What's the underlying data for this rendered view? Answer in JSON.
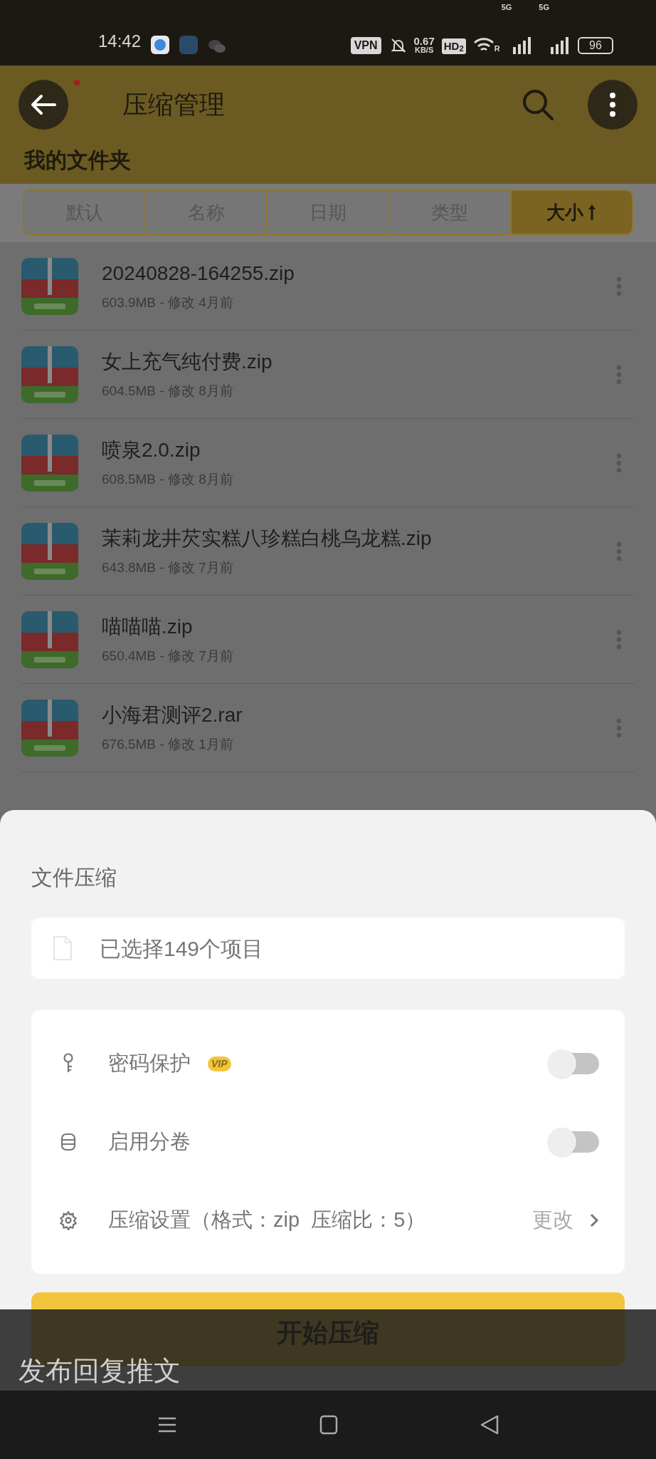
{
  "status_bar": {
    "time": "14:42",
    "vpn": "VPN",
    "speed": "0.67",
    "speed_unit": "KB/S",
    "hd": "HD$_{2}$",
    "roaming": "R",
    "network_1": "5G",
    "network_2": "5G",
    "battery": "96"
  },
  "header": {
    "title": "压缩管理",
    "section": "我的文件夹"
  },
  "sort_tabs": [
    {
      "label": "默认",
      "selected": false
    },
    {
      "label": "名称",
      "selected": false
    },
    {
      "label": "日期",
      "selected": false
    },
    {
      "label": "类型",
      "selected": false
    },
    {
      "label": "大小",
      "selected": true
    }
  ],
  "files": [
    {
      "name": "20240828-164255.zip",
      "meta": "603.9MB - 修改 4月前"
    },
    {
      "name": "女上充气纯付费.zip",
      "meta": "604.5MB - 修改 8月前"
    },
    {
      "name": "喷泉2.0.zip",
      "meta": "608.5MB - 修改 8月前"
    },
    {
      "name": "茉莉龙井芡实糕八珍糕白桃乌龙糕.zip",
      "meta": "643.8MB - 修改 7月前"
    },
    {
      "name": "喵喵喵.zip",
      "meta": "650.4MB - 修改 7月前"
    },
    {
      "name": "小海君测评2.rar",
      "meta": "676.5MB - 修改 1月前"
    }
  ],
  "sheet": {
    "title": "文件压缩",
    "selection": "已选择149个项目",
    "options": [
      {
        "kind": "toggle",
        "label": "密码保护",
        "badge": "VIP",
        "on": false
      },
      {
        "kind": "toggle",
        "label": "启用分卷",
        "on": false
      },
      {
        "kind": "link",
        "label": "压缩设置（格式：zip  压缩比：5）",
        "action": "更改"
      }
    ],
    "button": "开始压缩"
  },
  "reply_bar": {
    "text": "发布回复推文"
  }
}
